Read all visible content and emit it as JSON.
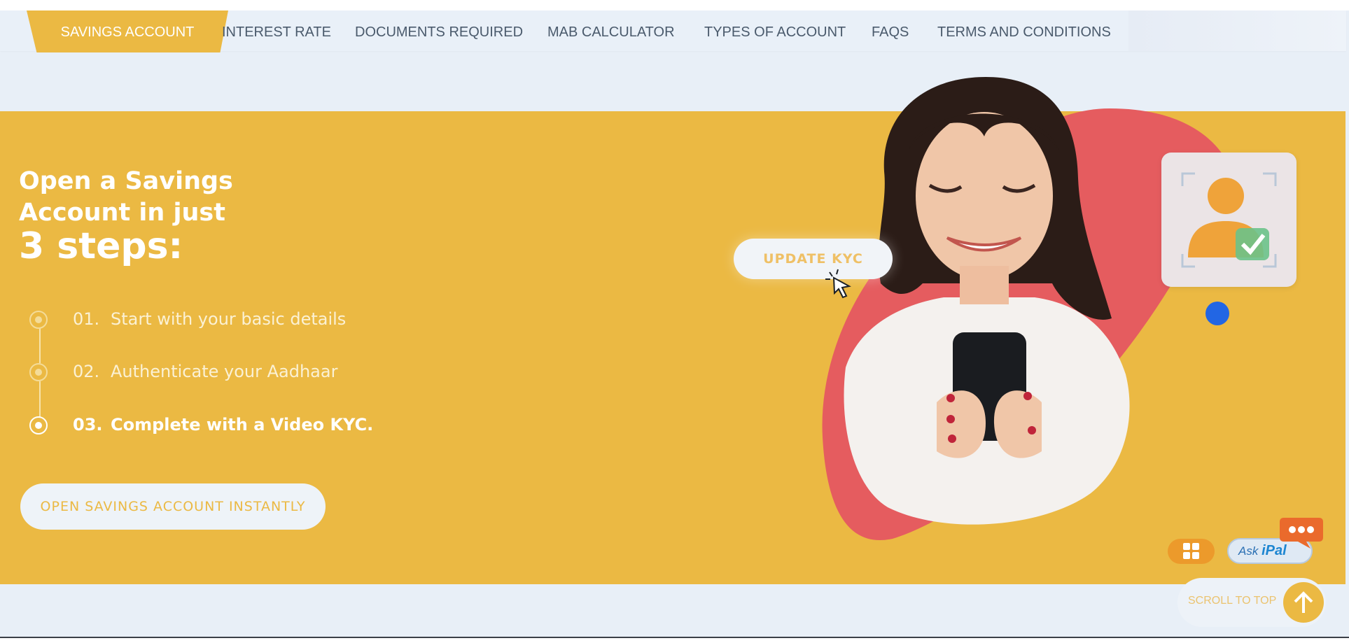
{
  "tabs": [
    {
      "label": "SAVINGS ACCOUNT",
      "active": true
    },
    {
      "label": "INTEREST RATE"
    },
    {
      "label": "DOCUMENTS REQUIRED"
    },
    {
      "label": "MAB CALCULATOR"
    },
    {
      "label": "TYPES OF ACCOUNT"
    },
    {
      "label": "FAQS"
    },
    {
      "label": "TERMS AND CONDITIONS"
    }
  ],
  "hero": {
    "heading_line1": "Open a Savings",
    "heading_line2": "Account in just",
    "heading_line3": "3 steps:",
    "steps": [
      {
        "num": "01.",
        "text": "Start with your basic details"
      },
      {
        "num": "02.",
        "text": "Authenticate your Aadhaar"
      },
      {
        "num": "03.",
        "text": "Complete with a Video KYC."
      }
    ],
    "cta_label": "OPEN SAVINGS ACCOUNT INSTANTLY",
    "kyc_button_label": "UPDATE KYC"
  },
  "widgets": {
    "ask_label_small": "Ask",
    "ask_label_big": "iPal",
    "scroll_to_top_label": "SCROLL TO TOP"
  },
  "colors": {
    "brand_yellow": "#ebb943",
    "accent_red": "#e55c5f",
    "page_bg": "#e8eff7",
    "blue_dot": "#2266e4"
  },
  "icons": {
    "cursor": "pointer-cursor-icon",
    "profile": "user-verified-icon",
    "apps": "apps-grid-icon",
    "chat": "chat-bubble-icon",
    "scroll": "arrow-up-icon"
  }
}
